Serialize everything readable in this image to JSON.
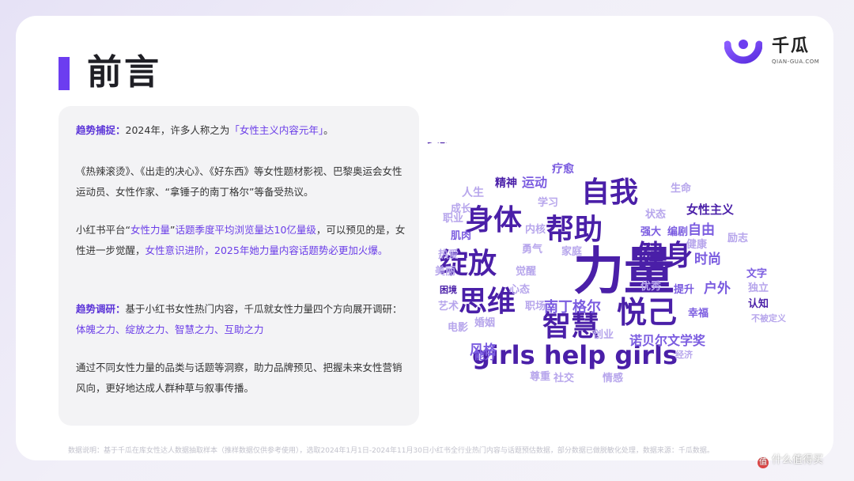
{
  "title": "前言",
  "logo": {
    "name": "千瓜",
    "sub": "QIAN-GUA.COM"
  },
  "colors": {
    "accent": "#6c3df0",
    "word_dark": "#4a1fa8",
    "word_mid": "#7b5ce0",
    "word_light": "#b7a6ec"
  },
  "trend_capture": {
    "label": "趋势捕捉：",
    "text": "2024年，许多人称之为",
    "highlight": "「女性主义内容元年」",
    "end": "。"
  },
  "para2": "《热辣滚烫》、《出走的决心》、《好东西》等女性题材影视、巴黎奥运会女性运动员、女性作家、“拿锤子的南丁格尔”等备受热议。",
  "para3": {
    "a": "小红书平台“",
    "b": "女性力量",
    "c": "”",
    "d": "话题季度平均浏览量达10亿量级",
    "e": "，可以预见的是，女性进一步觉醒，",
    "f": "女性意识进阶，2025年她力量内容话题势必更加火爆。"
  },
  "trend_research": {
    "label": "趋势调研：",
    "text": "基于小红书女性热门内容，千瓜就女性力量四个方向展开调研：",
    "highlight": "体魄之力、绽放之力、智慧之力、互助之力"
  },
  "para5": "通过不同女性力量的品类与话题等洞察，助力品牌预见、把握未来女性营销风向，更好地达成人群种草与叙事传播。",
  "footer": "数据说明：基于千瓜在库女性达人数据抽取样本（推样数据仅供参考使用），选取2024年1月1日-2024年11月30日小红书全行业热门内容与话题预估数据，部分数据已做脱敏化处理，数据来源：千瓜数据。",
  "watermark": "值 什么值得买",
  "word_cloud": [
    {
      "text": "力量",
      "size": 64,
      "tone": "dark"
    },
    {
      "text": "girls help girls",
      "size": 32,
      "tone": "dark"
    },
    {
      "text": "自我",
      "size": 36,
      "tone": "dark"
    },
    {
      "text": "身体",
      "size": 36,
      "tone": "dark"
    },
    {
      "text": "帮助",
      "size": 36,
      "tone": "dark"
    },
    {
      "text": "绽放",
      "size": 36,
      "tone": "dark"
    },
    {
      "text": "健身",
      "size": 36,
      "tone": "dark"
    },
    {
      "text": "思维",
      "size": 36,
      "tone": "dark"
    },
    {
      "text": "悦己",
      "size": 38,
      "tone": "dark"
    },
    {
      "text": "智慧",
      "size": 36,
      "tone": "dark"
    },
    {
      "text": "女性主义",
      "size": 15,
      "tone": "dark"
    },
    {
      "text": "南丁格尔",
      "size": 18,
      "tone": "mid"
    },
    {
      "text": "诺贝尔文学奖",
      "size": 16,
      "tone": "mid"
    },
    {
      "text": "自由",
      "size": 17,
      "tone": "mid"
    },
    {
      "text": "时尚",
      "size": 17,
      "tone": "mid"
    },
    {
      "text": "户外",
      "size": 17,
      "tone": "mid"
    },
    {
      "text": "风格",
      "size": 17,
      "tone": "mid"
    },
    {
      "text": "运动",
      "size": 16,
      "tone": "mid"
    },
    {
      "text": "精神",
      "size": 14,
      "tone": "dark"
    },
    {
      "text": "疗愈",
      "size": 14,
      "tone": "mid"
    },
    {
      "text": "生命",
      "size": 13,
      "tone": "light"
    },
    {
      "text": "人生",
      "size": 14,
      "tone": "light"
    },
    {
      "text": "学习",
      "size": 13,
      "tone": "light"
    },
    {
      "text": "成长",
      "size": 13,
      "tone": "light"
    },
    {
      "text": "职业",
      "size": 13,
      "tone": "light"
    },
    {
      "text": "状态",
      "size": 13,
      "tone": "light"
    },
    {
      "text": "强大",
      "size": 13,
      "tone": "mid"
    },
    {
      "text": "编剧",
      "size": 13,
      "tone": "mid"
    },
    {
      "text": "肌肉",
      "size": 13,
      "tone": "mid"
    },
    {
      "text": "内核",
      "size": 13,
      "tone": "light"
    },
    {
      "text": "健康",
      "size": 13,
      "tone": "light"
    },
    {
      "text": "励志",
      "size": 13,
      "tone": "light"
    },
    {
      "text": "热爱",
      "size": 13,
      "tone": "light"
    },
    {
      "text": "勇气",
      "size": 13,
      "tone": "light"
    },
    {
      "text": "家庭",
      "size": 13,
      "tone": "light"
    },
    {
      "text": "美丽",
      "size": 13,
      "tone": "light"
    },
    {
      "text": "觉醒",
      "size": 13,
      "tone": "light"
    },
    {
      "text": "文字",
      "size": 13,
      "tone": "mid"
    },
    {
      "text": "心态",
      "size": 13,
      "tone": "light"
    },
    {
      "text": "优秀",
      "size": 13,
      "tone": "light"
    },
    {
      "text": "提升",
      "size": 13,
      "tone": "mid"
    },
    {
      "text": "独立",
      "size": 13,
      "tone": "light"
    },
    {
      "text": "困境",
      "size": 11,
      "tone": "dark"
    },
    {
      "text": "职场",
      "size": 13,
      "tone": "light"
    },
    {
      "text": "幸福",
      "size": 13,
      "tone": "mid"
    },
    {
      "text": "认知",
      "size": 13,
      "tone": "dark"
    },
    {
      "text": "艺术",
      "size": 13,
      "tone": "light"
    },
    {
      "text": "婚姻",
      "size": 13,
      "tone": "light"
    },
    {
      "text": "不被定义",
      "size": 11,
      "tone": "light"
    },
    {
      "text": "电影",
      "size": 13,
      "tone": "light"
    },
    {
      "text": "创业",
      "size": 13,
      "tone": "light"
    },
    {
      "text": "能力",
      "size": 13,
      "tone": "mid"
    },
    {
      "text": "经济",
      "size": 11,
      "tone": "light"
    },
    {
      "text": "尊重",
      "size": 13,
      "tone": "light"
    },
    {
      "text": "社交",
      "size": 13,
      "tone": "light"
    },
    {
      "text": "情感",
      "size": 13,
      "tone": "light"
    },
    {
      "text": "梦想",
      "size": 13,
      "tone": "dark"
    }
  ]
}
